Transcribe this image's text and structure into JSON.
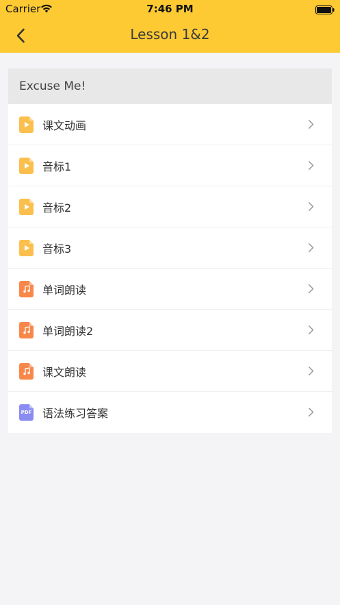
{
  "status_bar": {
    "carrier": "Carrier",
    "time": "7:46 PM"
  },
  "nav": {
    "title": "Lesson 1&2",
    "back_icon": "chevron-left-icon"
  },
  "colors": {
    "header_bg": "#fdca33",
    "video_icon": "#fbbf4e",
    "audio_icon": "#f8874a",
    "pdf_icon": "#8b8cf2"
  },
  "section": {
    "title": "Excuse Me!"
  },
  "items": [
    {
      "label": "课文动画",
      "icon": "video-file-icon"
    },
    {
      "label": "音标1",
      "icon": "video-file-icon"
    },
    {
      "label": "音标2",
      "icon": "video-file-icon"
    },
    {
      "label": "音标3",
      "icon": "video-file-icon"
    },
    {
      "label": "单词朗读",
      "icon": "audio-file-icon"
    },
    {
      "label": "单词朗读2",
      "icon": "audio-file-icon"
    },
    {
      "label": "课文朗读",
      "icon": "audio-file-icon"
    },
    {
      "label": "语法练习答案",
      "icon": "pdf-file-icon",
      "icon_text": "PDF"
    }
  ]
}
